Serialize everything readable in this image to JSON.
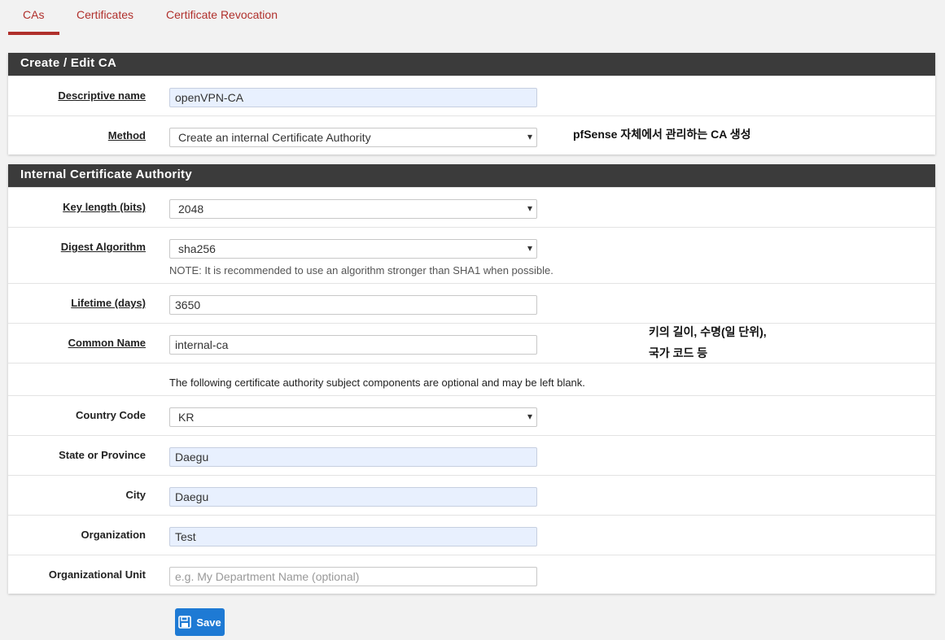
{
  "tabs": [
    "CAs",
    "Certificates",
    "Certificate Revocation"
  ],
  "panel1": {
    "title": "Create / Edit CA",
    "descriptive_name_label": "Descriptive name",
    "descriptive_name_value": "openVPN-CA",
    "method_label": "Method",
    "method_value": "Create an internal Certificate Authority"
  },
  "panel2": {
    "title": "Internal Certificate Authority",
    "key_length_label": "Key length (bits)",
    "key_length_value": "2048",
    "digest_label": "Digest Algorithm",
    "digest_value": "sha256",
    "digest_note": "NOTE: It is recommended to use an algorithm stronger than SHA1 when possible.",
    "lifetime_label": "Lifetime (days)",
    "lifetime_value": "3650",
    "common_name_label": "Common Name",
    "common_name_value": "internal-ca",
    "optional_note": "The following certificate authority subject components are optional and may be left blank.",
    "country_label": "Country Code",
    "country_value": "KR",
    "state_label": "State or Province",
    "state_value": "Daegu",
    "city_label": "City",
    "city_value": "Daegu",
    "org_label": "Organization",
    "org_value": "Test",
    "org_unit_label": "Organizational Unit",
    "org_unit_placeholder": "e.g. My Department Name (optional)"
  },
  "annotations": {
    "method_note": "pfSense 자체에서 관리하는 CA 생성",
    "key_note_line1": "키의 길이, 수명(일 단위),",
    "key_note_line2": "국가 코드 등"
  },
  "save_label": "Save",
  "colors": {
    "accent": "#b0302c",
    "header": "#3b3b3b",
    "button": "#1e7ad4"
  }
}
